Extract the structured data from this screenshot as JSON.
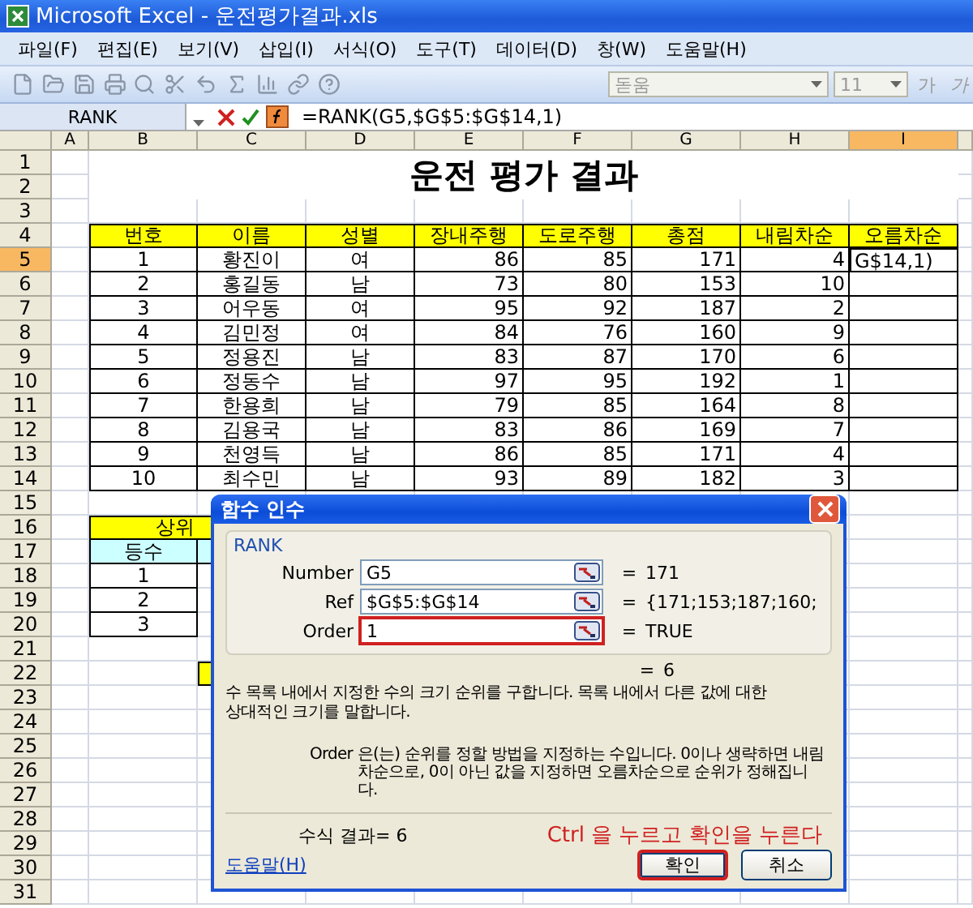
{
  "window": {
    "title": "Microsoft Excel - 운전평가결과.xls"
  },
  "menu": [
    "파일(F)",
    "편집(E)",
    "보기(V)",
    "삽입(I)",
    "서식(O)",
    "도구(T)",
    "데이터(D)",
    "창(W)",
    "도움말(H)"
  ],
  "toolbar": {
    "font_name": "돋움",
    "font_size": "11",
    "bold_label": "가",
    "italic_label": "가"
  },
  "formula_bar": {
    "name_box": "RANK",
    "formula": "=RANK(G5,$G$5:$G$14,1)"
  },
  "columns": [
    {
      "label": "A",
      "selected": false
    },
    {
      "label": "B",
      "selected": false
    },
    {
      "label": "C",
      "selected": false
    },
    {
      "label": "D",
      "selected": false
    },
    {
      "label": "E",
      "selected": false
    },
    {
      "label": "F",
      "selected": false
    },
    {
      "label": "G",
      "selected": false
    },
    {
      "label": "H",
      "selected": false
    },
    {
      "label": "I",
      "selected": true
    }
  ],
  "row_headers": [
    {
      "label": "1",
      "selected": false
    },
    {
      "label": "2",
      "selected": false
    },
    {
      "label": "3",
      "selected": false
    },
    {
      "label": "4",
      "selected": false
    },
    {
      "label": "5",
      "selected": true
    },
    {
      "label": "6",
      "selected": false
    },
    {
      "label": "7",
      "selected": false
    },
    {
      "label": "8",
      "selected": false
    },
    {
      "label": "9",
      "selected": false
    },
    {
      "label": "10",
      "selected": false
    },
    {
      "label": "11",
      "selected": false
    },
    {
      "label": "12",
      "selected": false
    },
    {
      "label": "13",
      "selected": false
    },
    {
      "label": "14",
      "selected": false
    },
    {
      "label": "15",
      "selected": false
    },
    {
      "label": "16",
      "selected": false
    },
    {
      "label": "17",
      "selected": false
    },
    {
      "label": "18",
      "selected": false
    },
    {
      "label": "19",
      "selected": false
    },
    {
      "label": "20",
      "selected": false
    },
    {
      "label": "21",
      "selected": false
    },
    {
      "label": "22",
      "selected": false
    },
    {
      "label": "23",
      "selected": false
    },
    {
      "label": "24",
      "selected": false
    },
    {
      "label": "25",
      "selected": false
    },
    {
      "label": "26",
      "selected": false
    },
    {
      "label": "27",
      "selected": false
    },
    {
      "label": "28",
      "selected": false
    },
    {
      "label": "29",
      "selected": false
    },
    {
      "label": "30",
      "selected": false
    },
    {
      "label": "31",
      "selected": false
    }
  ],
  "sheet": {
    "title": "운전 평가 결과",
    "table": {
      "columns": [
        "번호",
        "이름",
        "성별",
        "장내주행",
        "도로주행",
        "총점",
        "내림차순",
        "오름차순"
      ],
      "rows": [
        [
          "1",
          "황진이",
          "여",
          "86",
          "85",
          "171",
          "4"
        ],
        [
          "2",
          "홍길동",
          "남",
          "73",
          "80",
          "153",
          "10"
        ],
        [
          "3",
          "어우동",
          "여",
          "95",
          "92",
          "187",
          "2"
        ],
        [
          "4",
          "김민정",
          "여",
          "84",
          "76",
          "160",
          "9"
        ],
        [
          "5",
          "정용진",
          "남",
          "83",
          "87",
          "170",
          "6"
        ],
        [
          "6",
          "정동수",
          "남",
          "97",
          "95",
          "192",
          "1"
        ],
        [
          "7",
          "한용희",
          "남",
          "79",
          "85",
          "164",
          "8"
        ],
        [
          "8",
          "김용국",
          "남",
          "83",
          "86",
          "169",
          "7"
        ],
        [
          "9",
          "천영득",
          "남",
          "86",
          "85",
          "171",
          "4"
        ],
        [
          "10",
          "최수민",
          "남",
          "93",
          "89",
          "182",
          "3"
        ]
      ],
      "editing_cell": "G$14,1)"
    },
    "summary": {
      "title": "상위",
      "header": "등수",
      "ranks": [
        "1",
        "2",
        "3"
      ]
    }
  },
  "dialog": {
    "title": "함수 인수",
    "function": "RANK",
    "args": [
      {
        "label": "Number",
        "value": "G5",
        "result": "171",
        "highlighted": false
      },
      {
        "label": "Ref",
        "value": "$G$5:$G$14",
        "result": "{171;153;187;160;",
        "highlighted": false
      },
      {
        "label": "Order",
        "value": "1",
        "result": "TRUE",
        "highlighted": true
      }
    ],
    "equals": "=",
    "result": "6",
    "description": "수 목록 내에서 지정한 수의 크기 순위를 구합니다. 목록 내에서 다른 값에 대한 상대적인 크기를 말합니다.",
    "arg_name": "Order",
    "arg_help": "은(는) 순위를 정할 방법을 지정하는 수입니다. 0이나 생략하면 내림차순으로, 0이 아닌 값을 지정하면 오름차순으로 순위가 정해집니다.",
    "formula_result": "수식 결과= 6",
    "annotation": "Ctrl 을 누르고 확인을 누른다",
    "help_link": "도움말(H)",
    "buttons": [
      {
        "label": "확인",
        "highlighted": true
      },
      {
        "label": "취소",
        "highlighted": false
      }
    ]
  }
}
